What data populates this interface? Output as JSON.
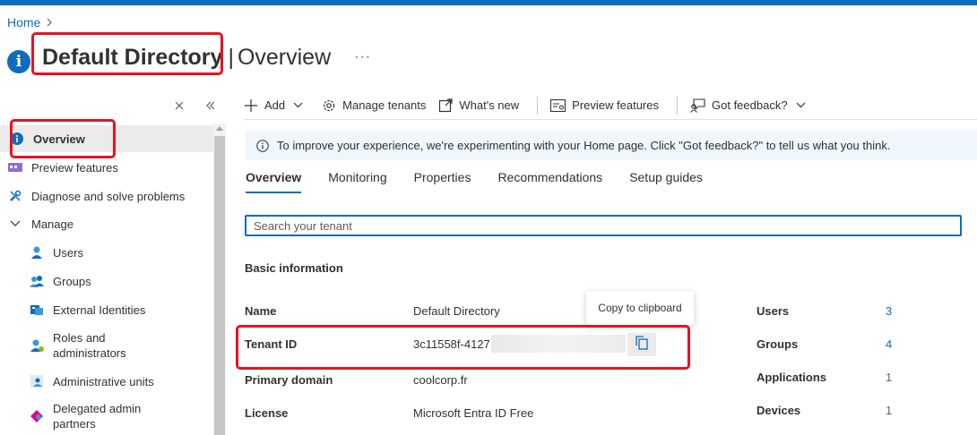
{
  "colors": {
    "accent": "#0f6cbd",
    "highlight": "#e81123"
  },
  "breadcrumb": {
    "home": "Home"
  },
  "header": {
    "title": "Default Directory",
    "separator": "|",
    "subtitle": "Overview",
    "more": "···"
  },
  "sidebar": {
    "items": [
      {
        "label": "Overview",
        "icon": "info-icon"
      },
      {
        "label": "Preview features",
        "icon": "preview-icon"
      },
      {
        "label": "Diagnose and solve problems",
        "icon": "wrench-icon"
      },
      {
        "label": "Manage",
        "icon": "chevron-down-icon"
      },
      {
        "label": "Users",
        "icon": "user-icon"
      },
      {
        "label": "Groups",
        "icon": "groups-icon"
      },
      {
        "label": "External Identities",
        "icon": "external-identities-icon"
      },
      {
        "label": "Roles and administrators",
        "icon": "roles-icon"
      },
      {
        "label": "Administrative units",
        "icon": "admin-units-icon"
      },
      {
        "label": "Delegated admin partners",
        "icon": "partners-icon"
      }
    ]
  },
  "toolbar": {
    "add": "Add",
    "manage_tenants": "Manage tenants",
    "whats_new": "What's new",
    "preview_features": "Preview features",
    "got_feedback": "Got feedback?"
  },
  "banner": {
    "text": "To improve your experience, we're experimenting with your Home page. Click \"Got feedback?\" to tell us what you think."
  },
  "tabs": [
    "Overview",
    "Monitoring",
    "Properties",
    "Recommendations",
    "Setup guides"
  ],
  "search": {
    "placeholder": "Search your tenant"
  },
  "basic_info": {
    "title": "Basic information",
    "rows": [
      {
        "label": "Name",
        "value": "Default Directory"
      },
      {
        "label": "Tenant ID",
        "value": "3c11558f-4127"
      },
      {
        "label": "Primary domain",
        "value": "coolcorp.fr"
      },
      {
        "label": "License",
        "value": "Microsoft Entra ID Free"
      }
    ]
  },
  "stats": [
    {
      "label": "Users",
      "value": "3"
    },
    {
      "label": "Groups",
      "value": "4"
    },
    {
      "label": "Applications",
      "value": "1"
    },
    {
      "label": "Devices",
      "value": "1"
    }
  ],
  "tooltip": {
    "text": "Copy to clipboard"
  }
}
